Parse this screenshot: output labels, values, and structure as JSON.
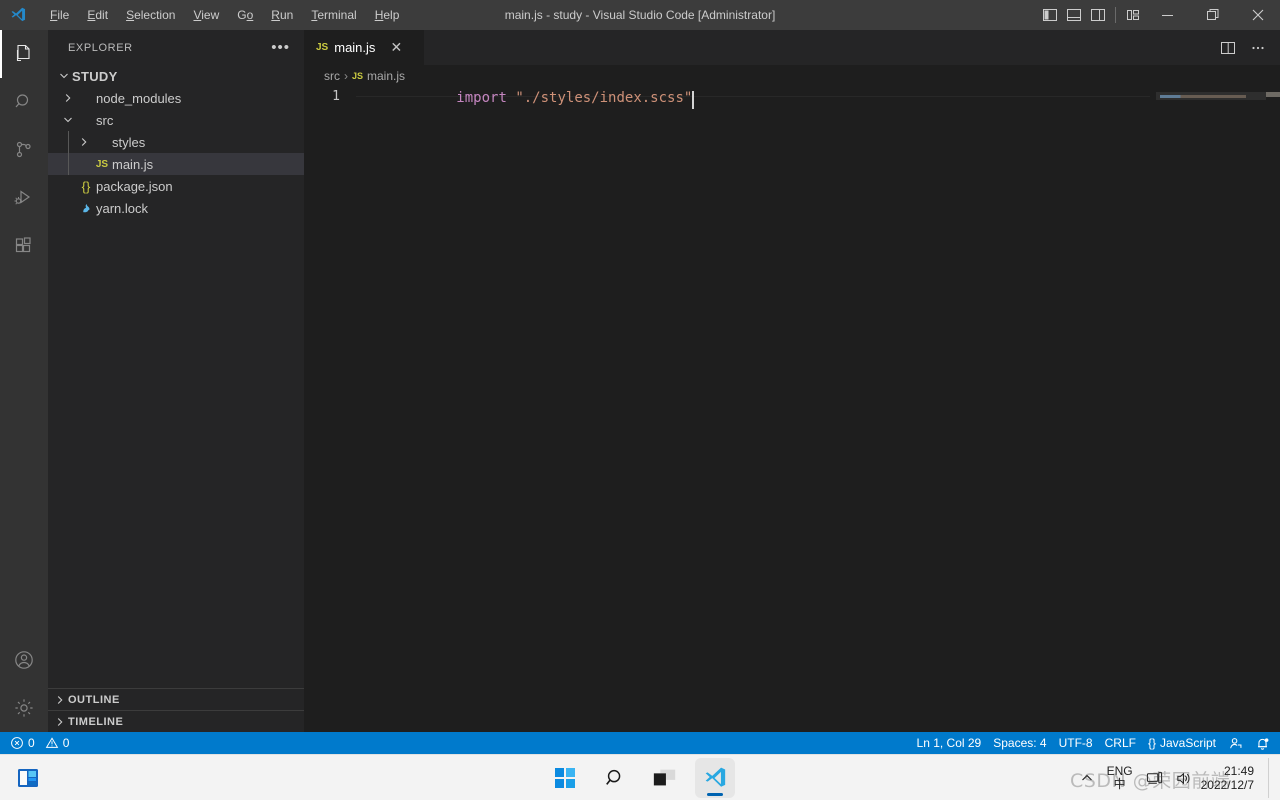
{
  "window": {
    "title": "main.js - study - Visual Studio Code [Administrator]",
    "logo_icon": "vscode-logo-icon",
    "menu": [
      {
        "label": "File",
        "accel": "F"
      },
      {
        "label": "Edit",
        "accel": "E"
      },
      {
        "label": "Selection",
        "accel": "S"
      },
      {
        "label": "View",
        "accel": "V"
      },
      {
        "label": "Go",
        "accel": "G"
      },
      {
        "label": "Run",
        "accel": "R"
      },
      {
        "label": "Terminal",
        "accel": "T"
      },
      {
        "label": "Help",
        "accel": "H"
      }
    ],
    "layout_controls": [
      {
        "name": "toggle-primary-sidebar-icon",
        "title": "Toggle Primary Side Bar"
      },
      {
        "name": "toggle-panel-icon",
        "title": "Toggle Panel"
      },
      {
        "name": "toggle-secondary-sidebar-icon",
        "title": "Toggle Secondary Side Bar"
      },
      {
        "name": "customize-layout-icon",
        "title": "Customize Layout"
      }
    ],
    "caption_buttons": [
      {
        "name": "minimize-button",
        "glyph": "—"
      },
      {
        "name": "maximize-button",
        "glyph": "❐"
      },
      {
        "name": "close-button",
        "glyph": "✕"
      }
    ]
  },
  "activity_bar": {
    "items": [
      {
        "name": "activity-explorer",
        "icon": "files-icon",
        "label": "Explorer",
        "active": true
      },
      {
        "name": "activity-search",
        "icon": "search-icon",
        "label": "Search",
        "active": false
      },
      {
        "name": "activity-source-control",
        "icon": "source-control-icon",
        "label": "Source Control",
        "active": false
      },
      {
        "name": "activity-run-debug",
        "icon": "run-and-debug-icon",
        "label": "Run and Debug",
        "active": false
      },
      {
        "name": "activity-extensions",
        "icon": "extensions-icon",
        "label": "Extensions",
        "active": false
      }
    ],
    "bottom_items": [
      {
        "name": "activity-accounts",
        "icon": "account-icon",
        "label": "Accounts"
      },
      {
        "name": "activity-settings",
        "icon": "gear-icon",
        "label": "Manage"
      }
    ]
  },
  "sidebar": {
    "header": {
      "title": "EXPLORER",
      "more_actions": "•••"
    },
    "root_folder": "STUDY",
    "tree": [
      {
        "label": "node_modules",
        "type": "folder",
        "expanded": false,
        "depth": 1,
        "icon": "chevron-right-icon"
      },
      {
        "label": "src",
        "type": "folder",
        "expanded": true,
        "depth": 1,
        "icon": "chevron-down-icon"
      },
      {
        "label": "styles",
        "type": "folder",
        "expanded": false,
        "depth": 2,
        "icon": "chevron-right-icon"
      },
      {
        "label": "main.js",
        "type": "file",
        "file_icon": "JS",
        "depth": 2,
        "selected": true
      },
      {
        "label": "package.json",
        "type": "file",
        "file_icon": "{}",
        "depth": 1,
        "selected": false
      },
      {
        "label": "yarn.lock",
        "type": "file",
        "file_icon": "lock-file-icon",
        "depth": 1,
        "selected": false
      }
    ],
    "sections": [
      {
        "label": "OUTLINE",
        "expanded": false
      },
      {
        "label": "TIMELINE",
        "expanded": false
      }
    ]
  },
  "editor": {
    "tabs": [
      {
        "label": "main.js",
        "file_icon": "JS",
        "active": true,
        "close_glyph": "✕"
      }
    ],
    "tab_actions": [
      {
        "name": "split-editor-right-button",
        "icon": "split-editor-icon"
      },
      {
        "name": "more-editor-actions-button",
        "icon": "ellipsis-icon"
      }
    ],
    "breadcrumbs": [
      {
        "label": "src",
        "icon": null
      },
      {
        "label": "main.js",
        "icon": "JS"
      }
    ],
    "code": {
      "lines": [
        {
          "number": "1",
          "tokens": [
            {
              "text": "import",
              "kind": "keyword"
            },
            {
              "text": " ",
              "kind": "plain"
            },
            {
              "text": "\"./styles/index.scss\"",
              "kind": "string"
            }
          ]
        }
      ]
    }
  },
  "status_bar": {
    "left": [
      {
        "name": "problems-errors",
        "icon": "error-circle-icon",
        "value": "0"
      },
      {
        "name": "problems-warnings",
        "icon": "warning-triangle-icon",
        "value": "0"
      }
    ],
    "right": [
      {
        "name": "editor-selection",
        "label": "Ln 1, Col 29"
      },
      {
        "name": "editor-indentation",
        "label": "Spaces: 4"
      },
      {
        "name": "editor-encoding",
        "label": "UTF-8"
      },
      {
        "name": "editor-eol",
        "label": "CRLF"
      },
      {
        "name": "editor-language",
        "label": "JavaScript",
        "icon": "{}"
      },
      {
        "name": "feedback-button",
        "icon": "tweet-feedback-icon"
      },
      {
        "name": "notifications-bell",
        "icon": "bell-dot-icon"
      }
    ]
  },
  "taskbar": {
    "left_items": [
      {
        "name": "widgets-button",
        "icon": "widgets-icon"
      }
    ],
    "center_items": [
      {
        "name": "start-button",
        "icon": "windows-start-icon",
        "active": false
      },
      {
        "name": "search-button",
        "icon": "search-icon",
        "active": false
      },
      {
        "name": "task-view-button",
        "icon": "task-view-icon",
        "active": false
      },
      {
        "name": "taskbar-vscode",
        "icon": "vscode-logo-icon",
        "active": true
      }
    ],
    "tray": {
      "overflow_glyph": "⌃",
      "ime": {
        "top": "ENG",
        "bottom": "中"
      },
      "icons": [
        {
          "name": "network-icon"
        },
        {
          "name": "volume-icon"
        }
      ],
      "clock": {
        "time": "21:49",
        "date": "2022/12/7"
      }
    }
  },
  "watermark": {
    "text": "CSDN @荣园前端"
  },
  "colors": {
    "titlebar_bg": "#3c3c3c",
    "activitybar_bg": "#333333",
    "sidebar_bg": "#252526",
    "editor_bg": "#1e1e1e",
    "statusbar_bg": "#007acc",
    "selection_bg": "#37373d",
    "keyword": "#c586c0",
    "string": "#ce9178",
    "js_icon": "#cbcb41",
    "taskbar_bg": "#f3f3f3"
  }
}
